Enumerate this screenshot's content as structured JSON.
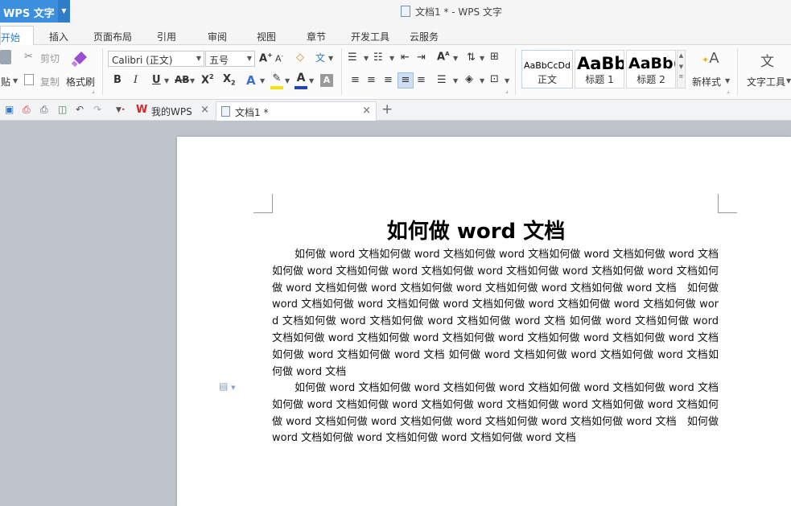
{
  "window": {
    "app_name": "WPS 文字",
    "title": "文档1 * - WPS 文字"
  },
  "menu": {
    "tabs": [
      "开始",
      "插入",
      "页面布局",
      "引用",
      "审阅",
      "视图",
      "章节",
      "开发工具",
      "云服务"
    ],
    "active": "开始"
  },
  "ribbon": {
    "paste_label": "贴",
    "cut_label": "剪切",
    "copy_label": "复制",
    "format_painter_label": "格式刷",
    "font_name": "Calibri (正文)",
    "font_size": "五号",
    "styles": [
      {
        "sample": "AaBbCcDd",
        "name": "正文"
      },
      {
        "sample": "AaBb",
        "name": "标题 1"
      },
      {
        "sample": "AaBb(",
        "name": "标题 2"
      }
    ],
    "new_style_label": "新样式",
    "text_tools_label": "文字工具",
    "accent_color": "#2b79d0",
    "highlight_color": "#ffe000",
    "font_color": "#1f3fd0"
  },
  "doc_tabs": [
    {
      "label": "我的WPS",
      "active": false
    },
    {
      "label": "文档1 *",
      "active": true
    }
  ],
  "document": {
    "heading": "如何做 word 文档",
    "paragraph1": "如何做 word 文档如何做 word 文档如何做 word 文档如何做 word 文档如何做 word 文档如何做 word 文档如何做 word 文档如何做 word 文档如何做 word 文档如何做 word 文档如何做 word 文档如何做 word 文档如何做 word 文档如何做 word 文档如何做 word 文档　如何做 word 文档如何做 word 文档如何做 word 文档如何做 word 文档如何做 word 文档如何做 word 文档如何做 word 文档如何做 word 文档如何做 word 文档 如何做 word 文档如何做 word 文档如何做 word 文档如何做 word 文档如何做 word 文档如何做 word 文档如何做 word 文档如何做 word 文档如何做 word 文档 如何做 word 文档如何做 word 文档如何做 word 文档如何做 word 文档",
    "paragraph2": "如何做 word 文档如何做 word 文档如何做 word 文档如何做 word 文档如何做 word 文档如何做 word 文档如何做 word 文档如何做 word 文档如何做 word 文档如何做 word 文档如何做 word 文档如何做 word 文档如何做 word 文档如何做 word 文档如何做 word 文档　如何做 word 文档如何做 word 文档如何做 word 文档如何做 word 文档"
  }
}
